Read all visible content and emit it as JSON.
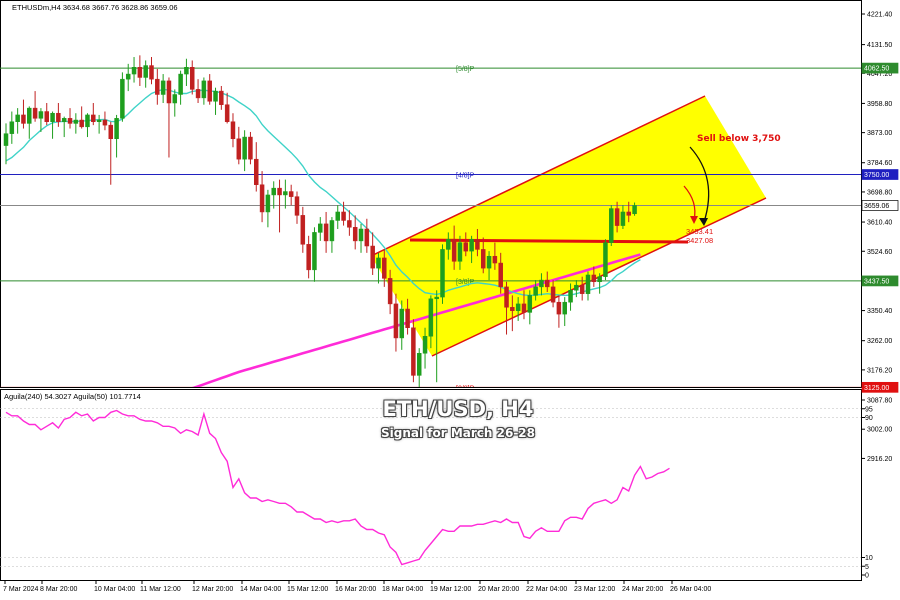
{
  "header": {
    "symbol_line": "ETHUSDm,H4  3634.68 3667.76 3628.86 3659.06",
    "indicator_line": "Aguila(240) 54.3027  Aguila(50) 101.7714"
  },
  "overlay": {
    "title": "ETH/USD, H4",
    "subtitle": "Signal for March 26-28"
  },
  "colors": {
    "up_candle": "#1e9e1e",
    "down_candle": "#c02020",
    "ma_short": "#3fd3c8",
    "ma_long": "#ff2bd8",
    "oscillator": "#ff2bd8",
    "channel_fill": "#ffff00",
    "channel_line": "#e01010",
    "level_green": "#2e8b2e",
    "level_blue": "#2020c0",
    "level_red": "#e01010",
    "annotation": "#e01010"
  },
  "chart_data": [
    {
      "type": "candlestick",
      "title": "ETHUSDm,H4",
      "y_ticks": [
        "4221.40",
        "4131.50",
        "4047.20",
        "3958.80",
        "3873.00",
        "3784.60",
        "3698.80",
        "3610.40",
        "3524.60",
        "3436.20",
        "3350.40",
        "3262.00",
        "3176.20",
        "3087.80",
        "3002.00",
        "2916.20"
      ],
      "ylim": [
        2916.2,
        4221.4
      ],
      "x_ticks": [
        "7 Mar 2024",
        "8 Mar 20:00",
        "10 Mar 04:00",
        "11 Mar 12:00",
        "12 Mar 20:00",
        "14 Mar 04:00",
        "15 Mar 12:00",
        "16 Mar 20:00",
        "18 Mar 04:00",
        "19 Mar 12:00",
        "20 Mar 20:00",
        "22 Mar 04:00",
        "23 Mar 12:00",
        "24 Mar 20:00",
        "26 Mar 04:00"
      ],
      "ohlc": [
        [
          3835,
          3900,
          3780,
          3870
        ],
        [
          3870,
          3935,
          3840,
          3905
        ],
        [
          3905,
          3945,
          3870,
          3925
        ],
        [
          3925,
          3970,
          3885,
          3900
        ],
        [
          3900,
          3950,
          3855,
          3945
        ],
        [
          3945,
          3995,
          3905,
          3915
        ],
        [
          3915,
          3945,
          3875,
          3935
        ],
        [
          3935,
          3960,
          3895,
          3905
        ],
        [
          3905,
          3935,
          3855,
          3930
        ],
        [
          3930,
          3960,
          3890,
          3905
        ],
        [
          3905,
          3920,
          3860,
          3915
        ],
        [
          3915,
          3945,
          3885,
          3900
        ],
        [
          3900,
          3930,
          3870,
          3910
        ],
        [
          3910,
          3950,
          3885,
          3890
        ],
        [
          3890,
          3930,
          3860,
          3925
        ],
        [
          3925,
          3960,
          3895,
          3905
        ],
        [
          3905,
          3925,
          3870,
          3910
        ],
        [
          3910,
          3935,
          3880,
          3895
        ],
        [
          3895,
          3905,
          3720,
          3855
        ],
        [
          3855,
          3925,
          3800,
          3915
        ],
        [
          3915,
          4050,
          3905,
          4030
        ],
        [
          4030,
          4075,
          3995,
          4045
        ],
        [
          4045,
          4095,
          4020,
          4065
        ],
        [
          4065,
          4100,
          4010,
          4035
        ],
        [
          4035,
          4085,
          4005,
          4070
        ],
        [
          4070,
          4095,
          4015,
          4030
        ],
        [
          4030,
          4060,
          3955,
          3985
        ],
        [
          3985,
          4045,
          3960,
          4025
        ],
        [
          4025,
          4035,
          3800,
          3960
        ],
        [
          3960,
          4000,
          3920,
          3985
        ],
        [
          3985,
          4055,
          3955,
          4045
        ],
        [
          4045,
          4090,
          4010,
          4065
        ],
        [
          4065,
          4085,
          3985,
          4000
        ],
        [
          4000,
          4030,
          3960,
          3975
        ],
        [
          3975,
          4035,
          3955,
          4025
        ],
        [
          4025,
          4045,
          3955,
          3965
        ],
        [
          3965,
          4005,
          3925,
          3995
        ],
        [
          3995,
          4010,
          3940,
          3955
        ],
        [
          3955,
          3990,
          3900,
          3905
        ],
        [
          3905,
          3930,
          3830,
          3855
        ],
        [
          3855,
          3890,
          3780,
          3795
        ],
        [
          3795,
          3880,
          3760,
          3860
        ],
        [
          3860,
          3875,
          3780,
          3795
        ],
        [
          3795,
          3845,
          3700,
          3720
        ],
        [
          3720,
          3760,
          3610,
          3640
        ],
        [
          3640,
          3705,
          3595,
          3690
        ],
        [
          3690,
          3730,
          3650,
          3710
        ],
        [
          3710,
          3735,
          3580,
          3690
        ],
        [
          3690,
          3735,
          3650,
          3700
        ],
        [
          3700,
          3720,
          3660,
          3685
        ],
        [
          3685,
          3700,
          3605,
          3630
        ],
        [
          3630,
          3655,
          3520,
          3545
        ],
        [
          3545,
          3570,
          3445,
          3470
        ],
        [
          3470,
          3595,
          3435,
          3580
        ],
        [
          3580,
          3625,
          3555,
          3605
        ],
        [
          3605,
          3640,
          3520,
          3555
        ],
        [
          3555,
          3625,
          3520,
          3615
        ],
        [
          3615,
          3660,
          3590,
          3640
        ],
        [
          3640,
          3670,
          3600,
          3615
        ],
        [
          3615,
          3645,
          3570,
          3595
        ],
        [
          3595,
          3630,
          3530,
          3555
        ],
        [
          3555,
          3605,
          3520,
          3590
        ],
        [
          3590,
          3620,
          3520,
          3540
        ],
        [
          3540,
          3580,
          3455,
          3475
        ],
        [
          3475,
          3520,
          3430,
          3505
        ],
        [
          3505,
          3530,
          3420,
          3445
        ],
        [
          3445,
          3470,
          3340,
          3370
        ],
        [
          3370,
          3400,
          3230,
          3270
        ],
        [
          3270,
          3380,
          3235,
          3355
        ],
        [
          3355,
          3385,
          3280,
          3300
        ],
        [
          3300,
          3325,
          3140,
          3160
        ],
        [
          3160,
          3240,
          3050,
          3225
        ],
        [
          3225,
          3300,
          3180,
          3275
        ],
        [
          3275,
          3395,
          3240,
          3385
        ],
        [
          3385,
          3410,
          3140,
          3390
        ],
        [
          3390,
          3545,
          3370,
          3530
        ],
        [
          3530,
          3580,
          3500,
          3560
        ],
        [
          3560,
          3600,
          3470,
          3495
        ],
        [
          3495,
          3570,
          3470,
          3550
        ],
        [
          3550,
          3580,
          3510,
          3525
        ],
        [
          3525,
          3570,
          3490,
          3560
        ],
        [
          3560,
          3590,
          3510,
          3530
        ],
        [
          3530,
          3565,
          3460,
          3475
        ],
        [
          3475,
          3525,
          3440,
          3510
        ],
        [
          3510,
          3550,
          3470,
          3490
        ],
        [
          3490,
          3520,
          3400,
          3420
        ],
        [
          3420,
          3435,
          3280,
          3360
        ],
        [
          3360,
          3395,
          3290,
          3350
        ],
        [
          3350,
          3390,
          3320,
          3370
        ],
        [
          3370,
          3410,
          3325,
          3345
        ],
        [
          3345,
          3410,
          3310,
          3395
        ],
        [
          3395,
          3440,
          3380,
          3420
        ],
        [
          3420,
          3460,
          3395,
          3440
        ],
        [
          3440,
          3465,
          3405,
          3420
        ],
        [
          3420,
          3440,
          3360,
          3375
        ],
        [
          3375,
          3395,
          3300,
          3340
        ],
        [
          3340,
          3390,
          3305,
          3375
        ],
        [
          3375,
          3430,
          3350,
          3410
        ],
        [
          3410,
          3440,
          3390,
          3425
        ],
        [
          3425,
          3450,
          3380,
          3400
        ],
        [
          3400,
          3465,
          3380,
          3455
        ],
        [
          3455,
          3480,
          3420,
          3435
        ],
        [
          3435,
          3460,
          3400,
          3450
        ],
        [
          3450,
          3560,
          3440,
          3550
        ],
        [
          3550,
          3660,
          3540,
          3650
        ],
        [
          3650,
          3670,
          3580,
          3600
        ],
        [
          3600,
          3660,
          3590,
          3640
        ],
        [
          3640,
          3670,
          3610,
          3630
        ],
        [
          3634.68,
          3667.76,
          3628.86,
          3659.06
        ]
      ],
      "series": [
        {
          "name": "",
          "values": [
            3790,
            3800,
            3815,
            3830,
            3850,
            3865,
            3880,
            3893,
            3902,
            3905,
            3906,
            3906,
            3906,
            3907,
            3908,
            3910,
            3911,
            3912,
            3906,
            3905,
            3913,
            3928,
            3945,
            3960,
            3975,
            3988,
            3995,
            4000,
            3998,
            3992,
            3988,
            3988,
            3994,
            3996,
            3998,
            3995,
            3994,
            3990,
            3983,
            3975,
            3963,
            3952,
            3940,
            3922,
            3897,
            3878,
            3862,
            3846,
            3830,
            3814,
            3796,
            3775,
            3748,
            3728,
            3712,
            3700,
            3685,
            3670,
            3655,
            3640,
            3624,
            3608,
            3592,
            3574,
            3556,
            3536,
            3512,
            3484,
            3464,
            3448,
            3430,
            3415,
            3403,
            3400,
            3398,
            3402,
            3410,
            3415,
            3420,
            3425,
            3430,
            3432,
            3430,
            3428,
            3425,
            3420,
            3412,
            3405,
            3400,
            3396,
            3395,
            3396,
            3398,
            3400,
            3398,
            3396,
            3395,
            3396,
            3400,
            3405,
            3410,
            3414,
            3418,
            3425,
            3438,
            3455,
            3465,
            3478,
            3490,
            3500
          ]
        },
        {
          "name": "",
          "values": [
            2950,
            2955,
            2960,
            2965,
            2970,
            2975,
            2980,
            2985,
            2990,
            2995,
            3000,
            3005,
            3010,
            3015,
            3020,
            3025,
            3030,
            3035,
            3040,
            3045,
            3050,
            3056,
            3062,
            3068,
            3074,
            3080,
            3086,
            3092,
            3098,
            3104,
            3110,
            3116,
            3122,
            3128,
            3134,
            3140,
            3146,
            3152,
            3158,
            3164,
            3170,
            3175,
            3180,
            3185,
            3190,
            3195,
            3200,
            3205,
            3210,
            3215,
            3220,
            3225,
            3230,
            3235,
            3240,
            3245,
            3250,
            3255,
            3260,
            3265,
            3270,
            3275,
            3280,
            3285,
            3290,
            3295,
            3300,
            3305,
            3310,
            3315,
            3320,
            3325,
            3330,
            3335,
            3340,
            3345,
            3350,
            3355,
            3360,
            3365,
            3370,
            3375,
            3380,
            3385,
            3390,
            3395,
            3400,
            3405,
            3410,
            3415,
            3420,
            3425,
            3430,
            3435,
            3440,
            3445,
            3450,
            3455,
            3460,
            3465,
            3470,
            3475,
            3480,
            3485,
            3490,
            3495,
            3500,
            3505,
            3510,
            3515
          ]
        }
      ],
      "levels": [
        {
          "label": "[5/8]P",
          "value": 4062.5,
          "price_tag": "4062.50",
          "color": "green"
        },
        {
          "label": "[4/8]P",
          "value": 3750.0,
          "price_tag": "3750.00",
          "color": "blue"
        },
        {
          "label": "",
          "value": 3659.06,
          "price_tag": "3659.06",
          "color": "gray"
        },
        {
          "label": "[3/8]P",
          "value": 3437.5,
          "price_tag": "3437.50",
          "color": "green"
        },
        {
          "label": "[2/8]P",
          "value": 3125.0,
          "price_tag": "3125.00",
          "color": "red"
        }
      ],
      "channel_labels": [
        "3453.41",
        "3427.08"
      ],
      "annotations": [
        "Sell below 3,750"
      ]
    },
    {
      "type": "line",
      "title": "Aguila(240) 54.3027  Aguila(50) 101.7714",
      "y_ticks": [
        "95",
        "90",
        "10",
        "5",
        "0"
      ],
      "ylim": [
        0,
        100
      ],
      "values": [
        93,
        91,
        91,
        88,
        86,
        86,
        83,
        85,
        87,
        84,
        89,
        90,
        93,
        91,
        92,
        88,
        90,
        90,
        93,
        94,
        92,
        91,
        91,
        89,
        88,
        88,
        87,
        85,
        85,
        84,
        81,
        83,
        82,
        80,
        92,
        81,
        78,
        70,
        65,
        50,
        55,
        47,
        44,
        44,
        42,
        43,
        42,
        41,
        41,
        39,
        36,
        36,
        34,
        32,
        32,
        30,
        31,
        30,
        31,
        31,
        32,
        28,
        26,
        26,
        24,
        23,
        16,
        13,
        6,
        7,
        8,
        9,
        14,
        18,
        22,
        26,
        25,
        25,
        28,
        28,
        28,
        29,
        29,
        30,
        31,
        30,
        32,
        30,
        30,
        22,
        21,
        25,
        27,
        25,
        25,
        25,
        31,
        33,
        33,
        32,
        38,
        41,
        42,
        43,
        41,
        43,
        50,
        48,
        57,
        62,
        55,
        56,
        58,
        59,
        61
      ]
    }
  ]
}
